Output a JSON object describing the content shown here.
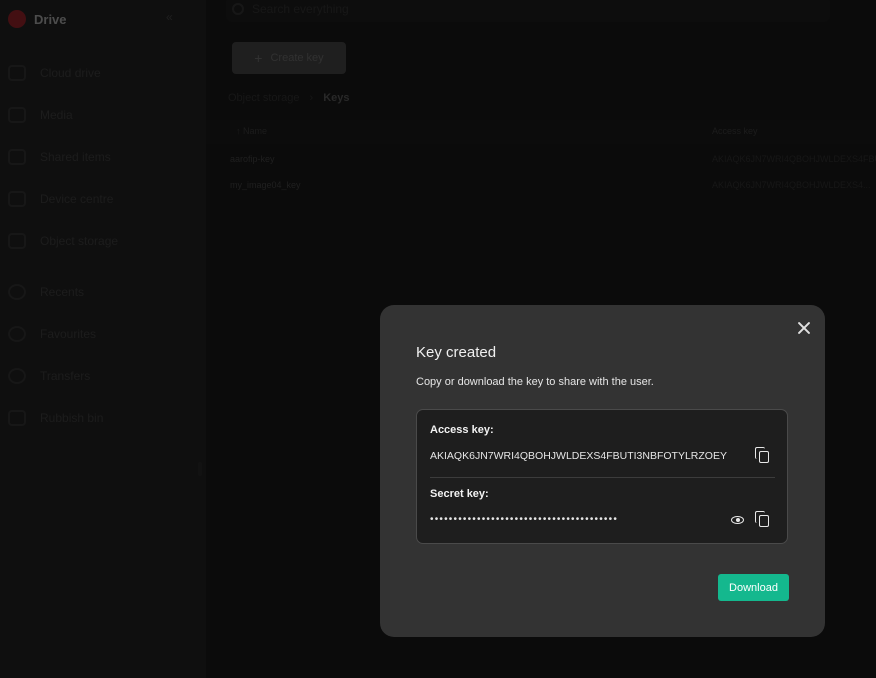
{
  "sidebar": {
    "brand": "Drive",
    "items": [
      {
        "label": "Cloud drive",
        "icon": "cloud-icon"
      },
      {
        "label": "Media",
        "icon": "media-icon"
      },
      {
        "label": "Shared items",
        "icon": "shared-icon"
      },
      {
        "label": "Device centre",
        "icon": "device-icon"
      },
      {
        "label": "Object storage",
        "icon": "object-storage-icon"
      },
      {
        "label": "Recents",
        "icon": "clock-icon"
      },
      {
        "label": "Favourites",
        "icon": "heart-icon"
      },
      {
        "label": "Transfers",
        "icon": "transfers-icon"
      },
      {
        "label": "Rubbish bin",
        "icon": "trash-icon"
      }
    ]
  },
  "main": {
    "search_placeholder": "Search everything",
    "create_key_label": "Create key",
    "breadcrumb": {
      "parent": "Object storage",
      "separator": "›",
      "current": "Keys"
    },
    "table": {
      "columns": [
        "Name",
        "Access key"
      ],
      "rows": [
        {
          "name": "aarofip-key",
          "access_key": "AKIAQK6JN7WRI4QBOHJWLDEXS4FBUTI..."
        },
        {
          "name": "my_image04_key",
          "access_key": "AKIAQK6JN7WRI4QBOHJWLDEXS4..."
        }
      ]
    }
  },
  "modal": {
    "title": "Key created",
    "description": "Copy or download the key to share with the user.",
    "access_key_label": "Access key:",
    "access_key_value": "AKIAQK6JN7WRI4QBOHJWLDEXS4FBUTI3NBFOTYLRZOEY",
    "secret_key_label": "Secret key:",
    "secret_key_masked": "••••••••••••••••••••••••••••••••••••••••",
    "download_label": "Download"
  },
  "colors": {
    "accent": "#14b88e",
    "modal_bg": "#333333",
    "key_box_bg": "#1e1e1e"
  }
}
